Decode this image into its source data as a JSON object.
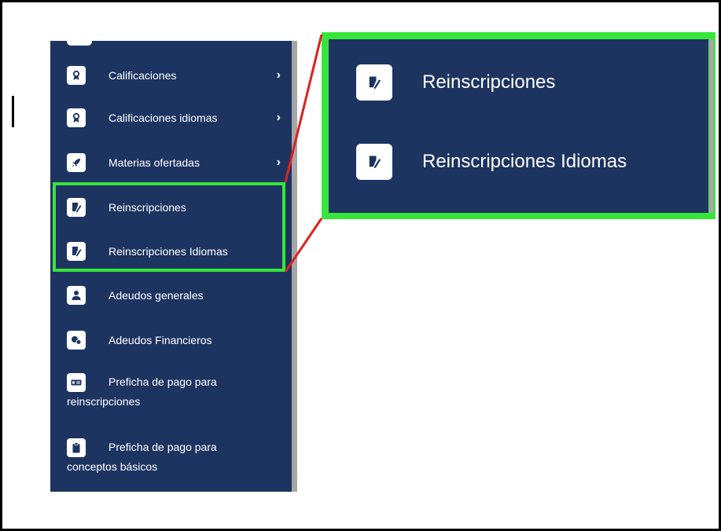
{
  "sidebar": {
    "items": [
      {
        "label": "Calificaciones",
        "icon": "award-icon",
        "chevron": "›"
      },
      {
        "label": "Calificaciones idiomas",
        "icon": "award-icon",
        "chevron": "›"
      },
      {
        "label": "Materias ofertadas",
        "icon": "rocket-icon",
        "chevron": "›"
      },
      {
        "label": "Reinscripciones",
        "icon": "edit-document-icon"
      },
      {
        "label": "Reinscripciones Idiomas",
        "icon": "edit-document-icon"
      },
      {
        "label": "Adeudos generales",
        "icon": "user-icon"
      },
      {
        "label": "Adeudos Financieros",
        "icon": "coins-icon"
      },
      {
        "line1": "Preficha de pago para",
        "line2": "reinscripciones",
        "icon": "money-bill-icon"
      },
      {
        "line1": "Preficha de pago para",
        "line2": "conceptos básicos",
        "icon": "clipboard-icon"
      }
    ]
  },
  "zoom": {
    "items": [
      {
        "label": "Reinscripciones",
        "icon": "edit-document-icon"
      },
      {
        "label": "Reinscripciones Idiomas",
        "icon": "edit-document-icon"
      }
    ]
  },
  "colors": {
    "sidebar_bg": "#1d3461",
    "highlight": "#37e63a",
    "connector": "#e02020",
    "text": "#ffffff"
  }
}
